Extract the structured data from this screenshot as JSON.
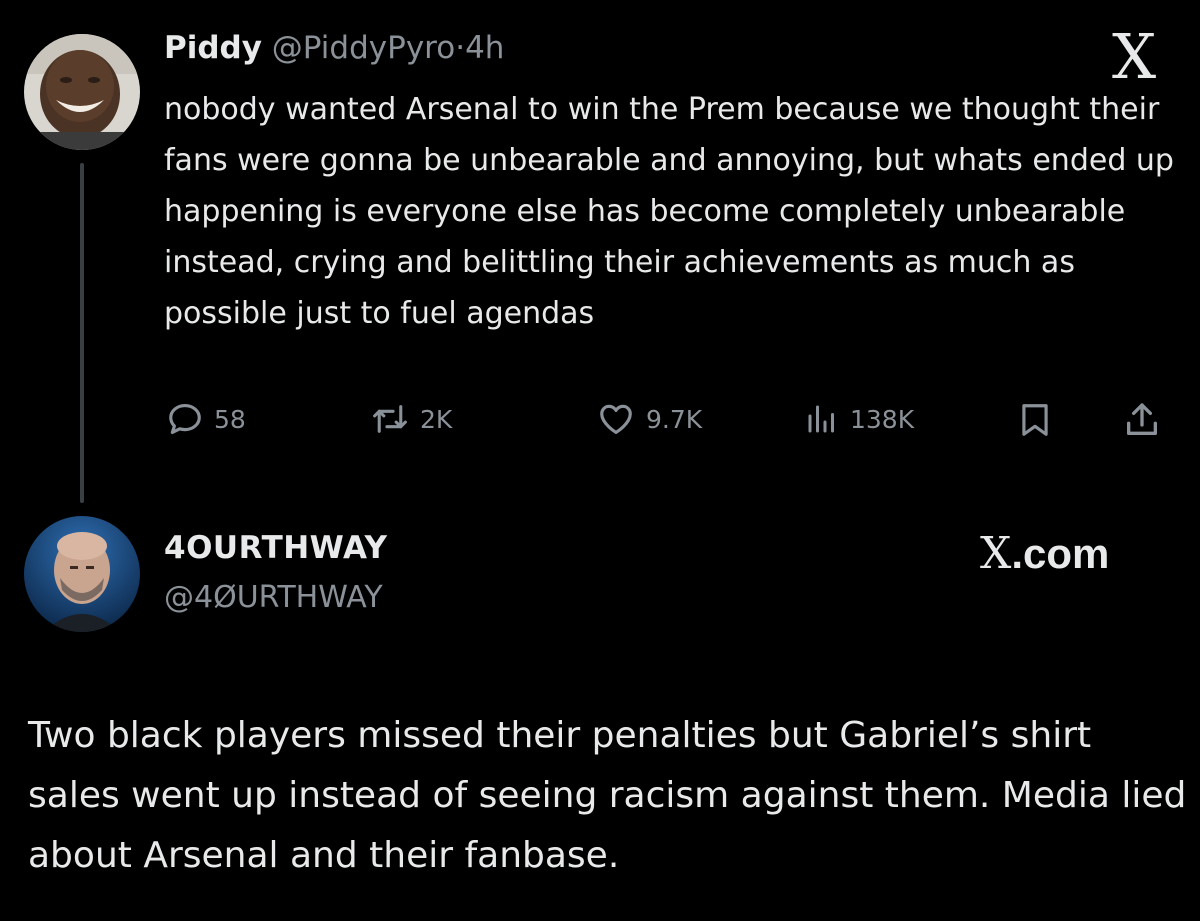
{
  "tweet1": {
    "author_name": "Piddy",
    "handle": "@PiddyPyro",
    "separator": "·",
    "time": "4h",
    "text": "nobody wanted Arsenal to win the Prem because we thought their fans were gonna be unbearable and annoying, but whats ended up happening is everyone else has become completely unbearable instead, crying and belittling their achievements as much as possible just to fuel agendas",
    "replies": "58",
    "reposts": "2K",
    "likes": "9.7K",
    "views": "138K",
    "corner_logo": "X"
  },
  "tweet2": {
    "author_name": "4OURTHWAY",
    "handle": "@4ØURTHWAY",
    "watermark_x": "X",
    "watermark_domain": ".com",
    "text": "Two black players missed their penalties but Gabriel’s shirt sales went up instead of seeing racism against them. Media lied about Arsenal and their fanbase."
  },
  "icons": {
    "reply": "reply-icon",
    "repost": "repost-icon",
    "like": "like-icon",
    "views": "views-icon",
    "bookmark": "bookmark-icon",
    "share": "share-icon"
  },
  "colors": {
    "background": "#000000",
    "text": "#e7e9ea",
    "muted": "#8b9198"
  }
}
